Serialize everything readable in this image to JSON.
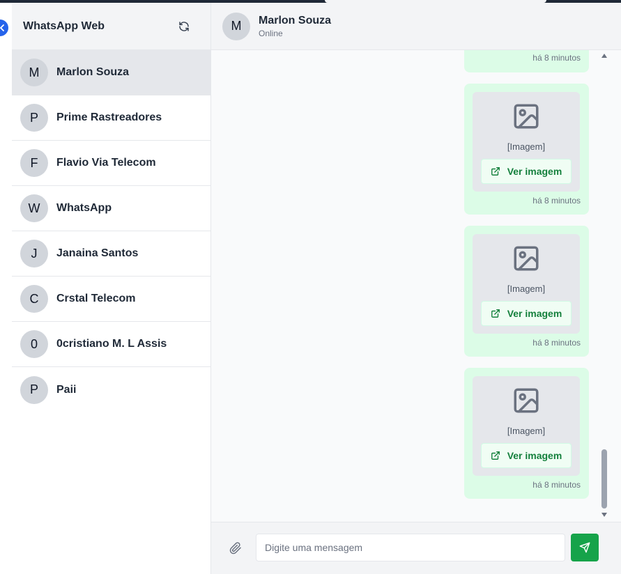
{
  "sidebar": {
    "title": "WhatsApp Web",
    "contacts": [
      {
        "initial": "M",
        "name": "Marlon Souza"
      },
      {
        "initial": "P",
        "name": "Prime Rastreadores"
      },
      {
        "initial": "F",
        "name": "Flavio Via Telecom"
      },
      {
        "initial": "W",
        "name": "WhatsApp"
      },
      {
        "initial": "J",
        "name": "Janaina Santos"
      },
      {
        "initial": "C",
        "name": "Crstal Telecom"
      },
      {
        "initial": "0",
        "name": "0cristiano M. L Assis"
      },
      {
        "initial": "P",
        "name": "Paii"
      }
    ]
  },
  "chat": {
    "initial": "M",
    "name": "Marlon Souza",
    "status": "Online",
    "messages": [
      {
        "time": "há 8 minutos"
      },
      {
        "caption": "[Imagem]",
        "button": "Ver imagem",
        "time": "há 8 minutos"
      },
      {
        "caption": "[Imagem]",
        "button": "Ver imagem",
        "time": "há 8 minutos"
      },
      {
        "caption": "[Imagem]",
        "button": "Ver imagem",
        "time": "há 8 minutos"
      }
    ]
  },
  "composer": {
    "placeholder": "Digite uma mensagem"
  },
  "colors": {
    "accent": "#16a34a",
    "bubble": "#dcfce7",
    "link_text": "#15803d",
    "collapse_button": "#2563eb"
  }
}
